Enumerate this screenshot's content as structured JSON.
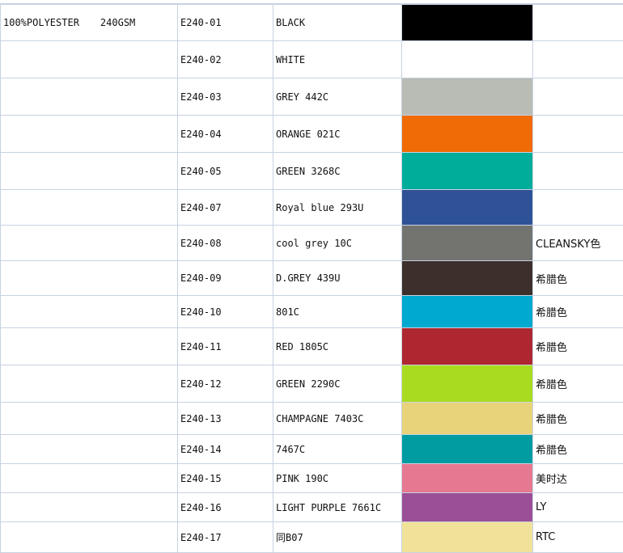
{
  "material": {
    "fabric": "100%POLYESTER",
    "weight": "240GSM"
  },
  "rows": [
    {
      "code": "E240-01",
      "color_name": "BLACK",
      "swatch": "#000000",
      "note": ""
    },
    {
      "code": "E240-02",
      "color_name": "WHITE",
      "swatch": "#ffffff",
      "note": ""
    },
    {
      "code": "E240-03",
      "color_name": "GREY 442C",
      "swatch": "#b9bcb5",
      "note": ""
    },
    {
      "code": "E240-04",
      "color_name": "ORANGE 021C",
      "swatch": "#f06a05",
      "note": ""
    },
    {
      "code": "E240-05",
      "color_name": "GREEN 3268C",
      "swatch": "#00ad9b",
      "note": ""
    },
    {
      "code": "E240-07",
      "color_name": "Royal blue 293U",
      "swatch": "#2f5296",
      "note": ""
    },
    {
      "code": "E240-08",
      "color_name": "cool grey 10C",
      "swatch": "#737470",
      "note": "CLEANSKY色"
    },
    {
      "code": "E240-09",
      "color_name": "D.GREY 439U",
      "swatch": "#3d2f2b",
      "note": "希腊色"
    },
    {
      "code": "E240-10",
      "color_name": "801C",
      "swatch": "#00a9cf",
      "note": "希腊色"
    },
    {
      "code": "E240-11",
      "color_name": "RED 1805C",
      "swatch": "#ae2730",
      "note": "希腊色"
    },
    {
      "code": "E240-12",
      "color_name": "GREEN 2290C",
      "swatch": "#a9dc1e",
      "note": "希腊色"
    },
    {
      "code": "E240-13",
      "color_name": "CHAMPAGNE  7403C",
      "swatch": "#e9d37a",
      "note": "希腊色"
    },
    {
      "code": "E240-14",
      "color_name": "7467C",
      "swatch": "#009ca1",
      "note": "希腊色"
    },
    {
      "code": "E240-15",
      "color_name": "PINK 190C",
      "swatch": "#e67991",
      "note": "美时达"
    },
    {
      "code": "E240-16",
      "color_name": "LIGHT PURPLE 7661C",
      "swatch": "#9b4f97",
      "note": "LY"
    },
    {
      "code": "E240-17",
      "color_name": "同B07",
      "swatch": "#f1e29a",
      "note": "RTC"
    }
  ]
}
